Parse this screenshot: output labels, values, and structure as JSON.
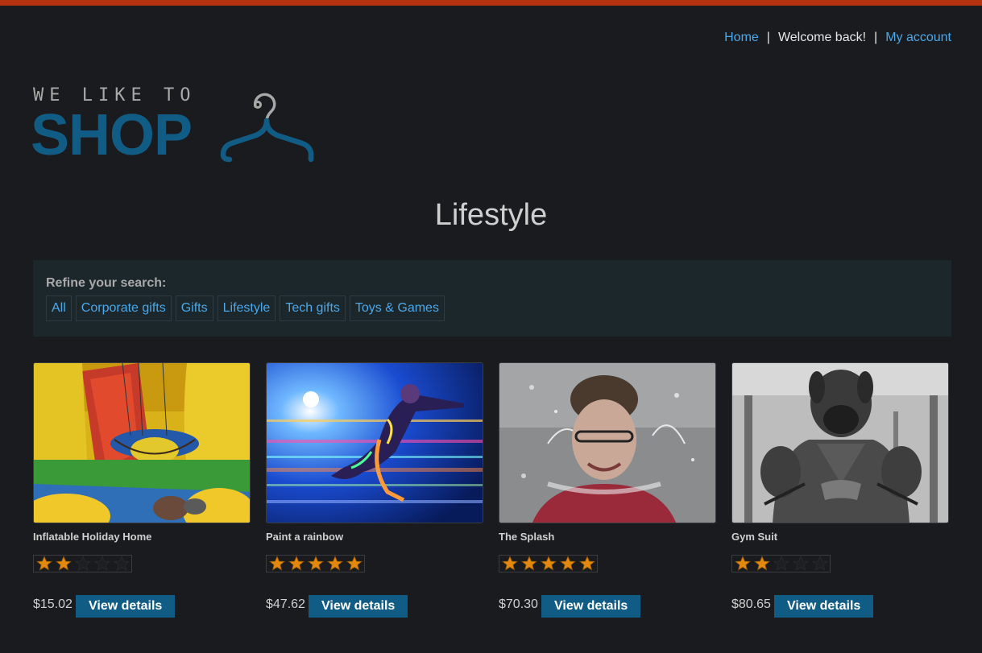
{
  "header": {
    "home_link": "Home",
    "welcome_text": "Welcome back!",
    "account_link": "My account",
    "separator": "|"
  },
  "logo": {
    "top_text": "WE LIKE TO",
    "main_text": "SHOP"
  },
  "page_title": "Lifestyle",
  "filters": {
    "label": "Refine your search:",
    "categories": [
      "All",
      "Corporate gifts",
      "Gifts",
      "Lifestyle",
      "Tech gifts",
      "Toys & Games"
    ]
  },
  "products": [
    {
      "name": "Inflatable Holiday Home",
      "price": "$15.02",
      "rating": 2,
      "button": "View details"
    },
    {
      "name": "Paint a rainbow",
      "price": "$47.62",
      "rating": 5,
      "button": "View details"
    },
    {
      "name": "The Splash",
      "price": "$70.30",
      "rating": 5,
      "button": "View details"
    },
    {
      "name": "Gym Suit",
      "price": "$80.65",
      "rating": 2,
      "button": "View details"
    }
  ],
  "colors": {
    "accent_bar": "#b5320e",
    "link": "#4aa8ea",
    "brand_blue": "#115c84",
    "star_filled": "#e3890e"
  }
}
